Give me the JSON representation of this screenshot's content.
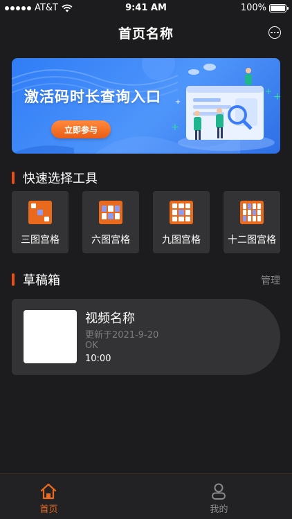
{
  "status_bar": {
    "carrier": "AT&T",
    "time": "9:41 AM",
    "battery": "100%",
    "battery_level": 1.0
  },
  "nav": {
    "title": "首页名称",
    "more_icon": "more-dots-icon"
  },
  "banner": {
    "title": "激活码时长查询入口",
    "button_label": "立即参与"
  },
  "tools_section": {
    "title": "快速选择工具",
    "items": [
      {
        "label": "三图宫格",
        "icon": "grid-3-icon"
      },
      {
        "label": "六图宫格",
        "icon": "grid-6-icon"
      },
      {
        "label": "九图宫格",
        "icon": "grid-9-icon"
      },
      {
        "label": "十二图宫格",
        "icon": "grid-12-icon"
      }
    ]
  },
  "drafts_section": {
    "title": "草稿箱",
    "manage_label": "管理",
    "items": [
      {
        "name": "视频名称",
        "updated": "更新于2021-9-20",
        "status": "OK",
        "duration": "10:00"
      }
    ]
  },
  "tab_bar": {
    "tabs": [
      {
        "label": "首页",
        "icon": "home-icon",
        "active": true
      },
      {
        "label": "我的",
        "icon": "profile-icon",
        "active": false
      }
    ]
  },
  "colors": {
    "accent": "#EA6B1E",
    "background": "#1C1C1E",
    "card": "#333335",
    "banner": "#3A86F7"
  }
}
